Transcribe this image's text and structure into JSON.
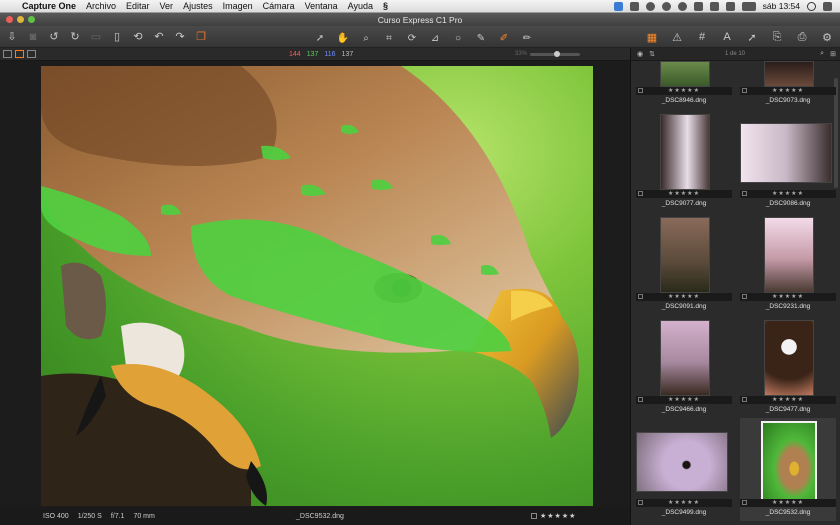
{
  "menubar": {
    "app_name": "Capture One",
    "items": [
      "Archivo",
      "Editar",
      "Ver",
      "Ajustes",
      "Imagen",
      "Cámara",
      "Ventana",
      "Ayuda"
    ],
    "clock": "sáb 13:54"
  },
  "window": {
    "title": "Curso Express C1 Pro"
  },
  "viewer": {
    "rgb_readout": {
      "r": "144",
      "g": "137",
      "b": "116",
      "l": "137"
    },
    "zoom_label": "33%",
    "zoom_level": 0.55
  },
  "status": {
    "iso": "ISO 400",
    "shutter": "1/250 S",
    "aperture": "f/7.1",
    "focal": "70 mm",
    "filename": "_DSC9532.dng",
    "stars": "★★★★★"
  },
  "browser": {
    "count": "1 de 10",
    "thumbnails": [
      {
        "name": "_DSC8946.dng",
        "stars": "★★★★★"
      },
      {
        "name": "_DSC9073.dng",
        "stars": "★★★★★"
      },
      {
        "name": "_DSC9077.dng",
        "stars": "★★★★★"
      },
      {
        "name": "_DSC9086.dng",
        "stars": "★★★★★"
      },
      {
        "name": "_DSC9091.dng",
        "stars": "★★★★★"
      },
      {
        "name": "_DSC9231.dng",
        "stars": "★★★★★"
      },
      {
        "name": "_DSC9466.dng",
        "stars": "★★★★★"
      },
      {
        "name": "_DSC9477.dng",
        "stars": "★★★★★"
      },
      {
        "name": "_DSC9499.dng",
        "stars": "★★★★★"
      },
      {
        "name": "_DSC9532.dng",
        "stars": "★★★★★"
      }
    ]
  },
  "colors": {
    "accent": "#ff7a1a",
    "mask_green": "#4fd040"
  }
}
